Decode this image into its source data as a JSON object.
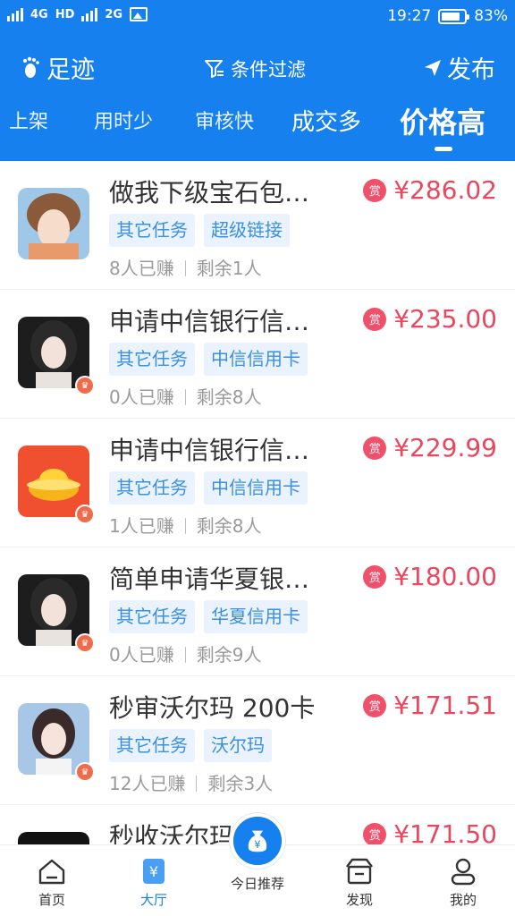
{
  "status_bar": {
    "network_1": "4G",
    "hd": "HD",
    "network_2": "2G",
    "time": "19:27",
    "battery": "83%",
    "battery_level": 0.83
  },
  "toolbar": {
    "footprint_label": "足迹",
    "filter_label": "条件过滤",
    "publish_label": "发布"
  },
  "tabs": [
    {
      "label": "上架"
    },
    {
      "label": "用时少"
    },
    {
      "label": "审核快"
    },
    {
      "label": "成交多"
    },
    {
      "label": "价格高",
      "active": true
    }
  ],
  "tasks": [
    {
      "title": "做我下级宝石包…",
      "tags": [
        "其它任务",
        "超级链接"
      ],
      "earned": "8人已赚",
      "remaining": "剩余1人",
      "price": "¥286.02",
      "reward_badge": "赏",
      "avatar": "girl-helmet"
    },
    {
      "title": "申请中信银行信…",
      "tags": [
        "其它任务",
        "中信信用卡"
      ],
      "earned": "0人已赚",
      "remaining": "剩余8人",
      "price": "¥235.00",
      "reward_badge": "赏",
      "avatar": "girl-dark"
    },
    {
      "title": "申请中信银行信…",
      "tags": [
        "其它任务",
        "中信信用卡"
      ],
      "earned": "1人已赚",
      "remaining": "剩余8人",
      "price": "¥229.99",
      "reward_badge": "赏",
      "avatar": "gold-ingot"
    },
    {
      "title": "简单申请华夏银…",
      "tags": [
        "其它任务",
        "华夏信用卡"
      ],
      "earned": "0人已赚",
      "remaining": "剩余9人",
      "price": "¥180.00",
      "reward_badge": "赏",
      "avatar": "girl-dark"
    },
    {
      "title": "秒审沃尔玛 200卡",
      "tags": [
        "其它任务",
        "沃尔玛"
      ],
      "earned": "12人已赚",
      "remaining": "剩余3人",
      "price": "¥171.51",
      "reward_badge": "赏",
      "avatar": "girl-light"
    },
    {
      "title": "秒收沃尔玛",
      "tags": [],
      "earned": "",
      "remaining": "",
      "price": "¥171.50",
      "reward_badge": "赏",
      "avatar": "dark"
    }
  ],
  "bottom_nav": {
    "home": "首页",
    "hall": "大厅",
    "today": "今日推荐",
    "discover": "发现",
    "mine": "我的"
  },
  "colors": {
    "primary": "#1580ee",
    "price": "#e8475e",
    "tag_bg": "#eaf3fd",
    "tag_text": "#3a8fe0"
  }
}
